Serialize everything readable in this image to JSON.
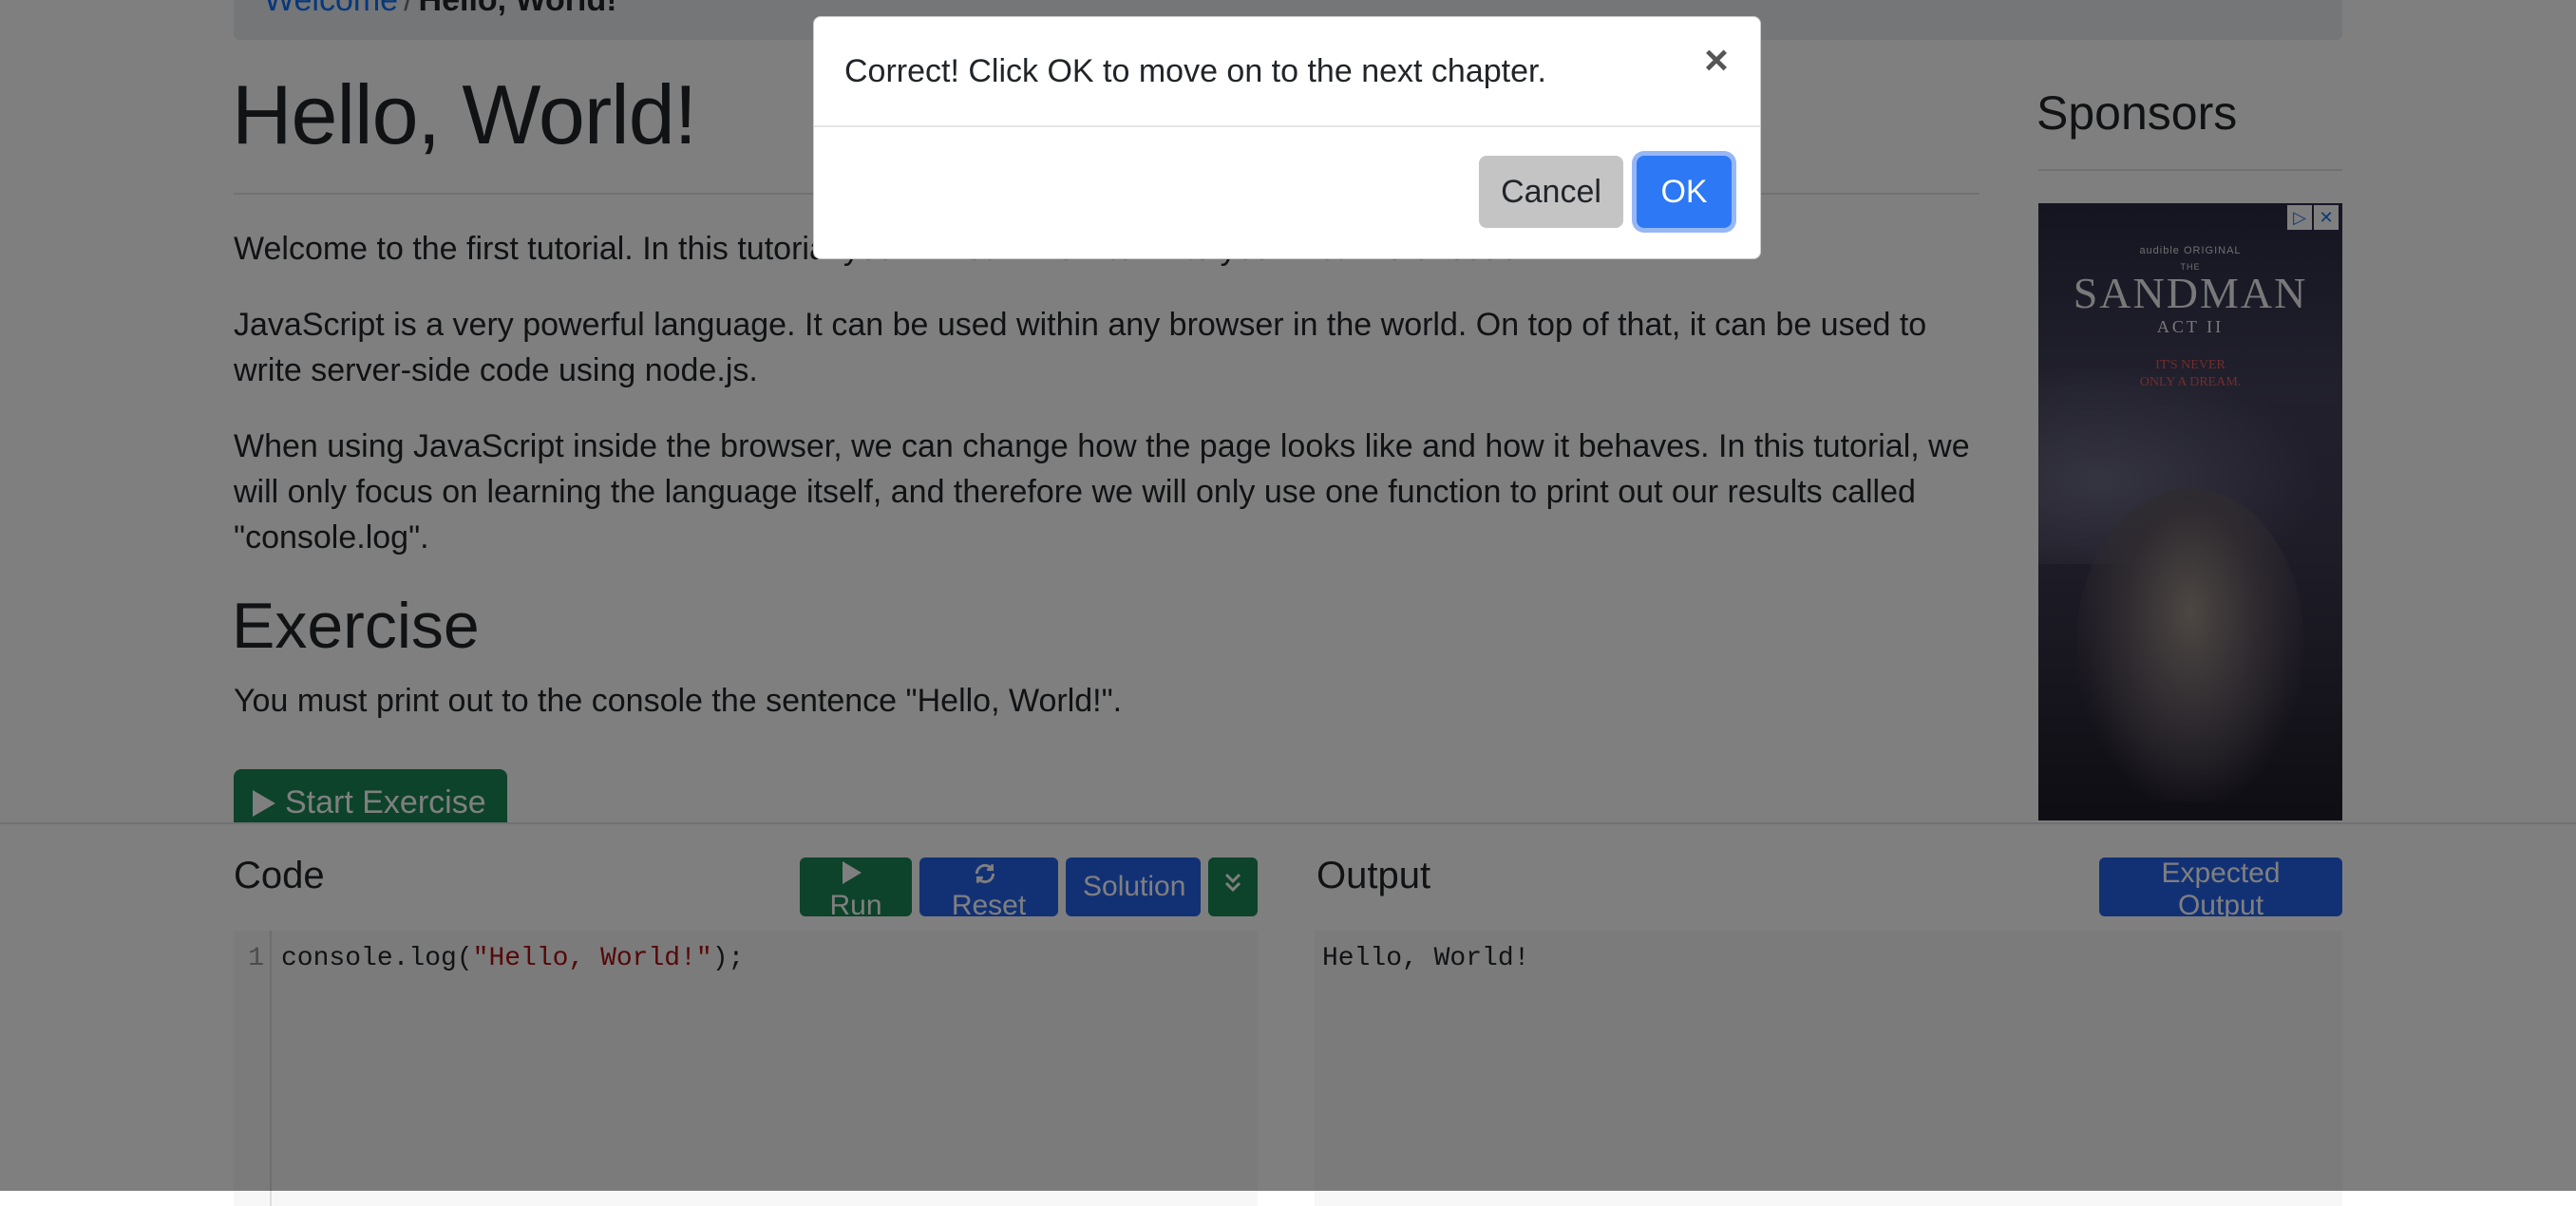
{
  "breadcrumb": {
    "parent": "Welcome",
    "separator": "/",
    "current": "Hello, World!"
  },
  "page": {
    "title": "Hello, World!",
    "paragraphs": [
      "Welcome to the first tutorial. In this tutorial you will learn how to write your first line of code.",
      "JavaScript is a very powerful language. It can be used within any browser in the world. On top of that, it can be used to write server-side code using node.js.",
      "When using JavaScript inside the browser, we can change how the page looks like and how it behaves. In this tutorial, we will only focus on learning the language itself, and therefore we will only use one function to print out our results called \"console.log\"."
    ],
    "exercise_heading": "Exercise",
    "exercise_text": "You must print out to the console the sentence \"Hello, World!\".",
    "start_button": "Start Exercise"
  },
  "sidebar": {
    "title": "Sponsors",
    "ad": {
      "publisher": "audible ORIGINAL",
      "over_title": "THE",
      "title": "SANDMAN",
      "subtitle": "ACT II",
      "tagline_1": "IT'S NEVER",
      "tagline_2": "ONLY A DREAM.",
      "icon_adchoices": "ad-choices-icon",
      "icon_close": "close-icon"
    }
  },
  "code_panel": {
    "heading": "Code",
    "run": "Run",
    "reset": "Reset",
    "solution": "Solution",
    "expand_icon": "chevron-double-down-icon",
    "line_number": "1",
    "code_prefix": "console.log(",
    "code_string": "\"Hello, World!\"",
    "code_suffix": ");"
  },
  "output_panel": {
    "heading": "Output",
    "expected_button": "Expected Output",
    "text": "Hello, World!"
  },
  "modal": {
    "message": "Correct! Click OK to move on to the next chapter.",
    "close": "×",
    "cancel": "Cancel",
    "ok": "OK"
  },
  "colors": {
    "primary": "#2563eb",
    "success": "#198754",
    "ok_button": "#2d78f4",
    "string_literal": "#aa1111"
  }
}
